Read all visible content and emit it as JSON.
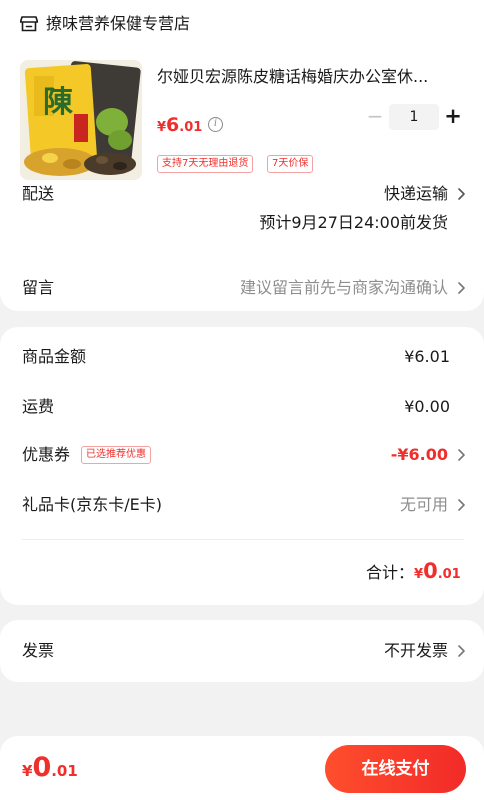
{
  "store": {
    "name": "撩味营养保健专营店",
    "icon": "store-icon"
  },
  "product": {
    "title": "尔娅贝宏源陈皮糖话梅婚庆办公室休...",
    "price": {
      "currency": "¥",
      "integer": "6",
      "decimal": ".01"
    },
    "tags": [
      "支持7天无理由退货",
      "7天价保"
    ],
    "quantity": "1",
    "image_text": "陳"
  },
  "delivery": {
    "label": "配送",
    "method": "快递运输",
    "eta": "预计9月27日24:00前发货"
  },
  "message": {
    "label": "留言",
    "placeholder": "建议留言前先与商家沟通确认"
  },
  "summary": {
    "goods_label": "商品金额",
    "goods_value": "¥6.01",
    "shipping_label": "运费",
    "shipping_value": "¥0.00",
    "coupon_label": "优惠券",
    "coupon_badge": "已选推荐优惠",
    "coupon_value": "-¥6.00",
    "giftcard_label": "礼品卡(京东卡/E卡)",
    "giftcard_value": "无可用",
    "total_label": "合计：",
    "total": {
      "currency": "¥",
      "integer": "0",
      "decimal": ".01"
    }
  },
  "invoice": {
    "label": "发票",
    "value": "不开发票"
  },
  "footer": {
    "price": {
      "currency": "¥",
      "integer": "0",
      "decimal": ".01"
    },
    "pay_label": "在线支付"
  },
  "colors": {
    "accent": "#ef2f2b",
    "muted": "#8e8e8e",
    "background": "#f2f2f2"
  }
}
